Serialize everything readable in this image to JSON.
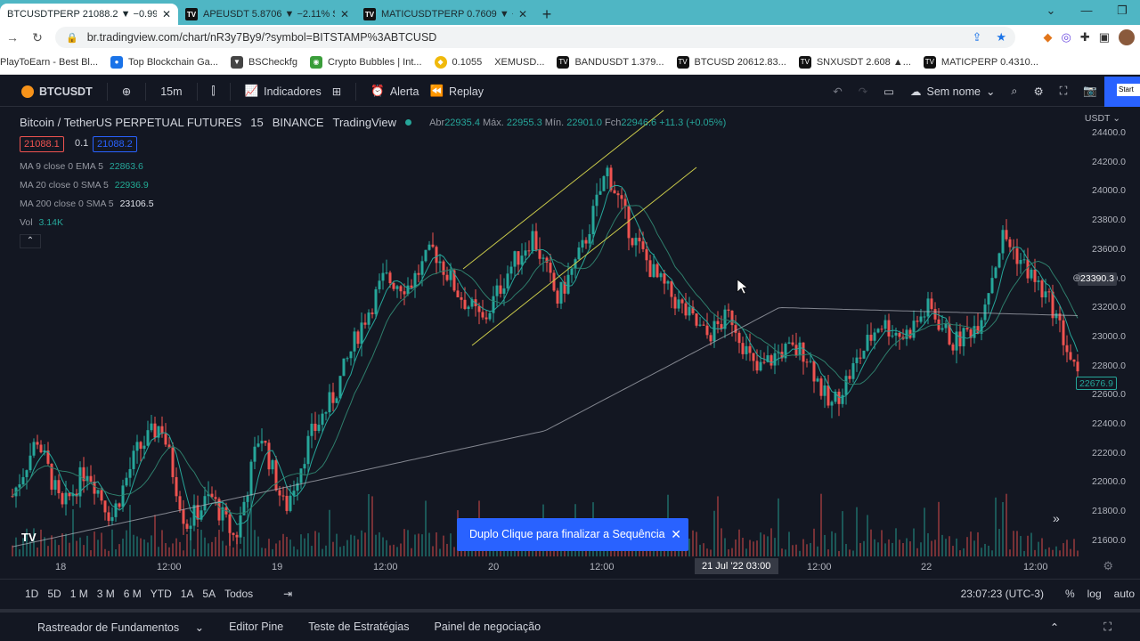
{
  "browser": {
    "tabs": [
      {
        "label": "BTCUSDTPERP 21088.2 ▼ −0.99%",
        "active": true
      },
      {
        "label": "APEUSDT 5.8706 ▼ −2.11% Sem",
        "active": false
      },
      {
        "label": "MATICUSDTPERP 0.7609 ▼ −1.1",
        "active": false
      }
    ],
    "url": "br.tradingview.com/chart/nR3y7By9/?symbol=BITSTAMP%3ABTCUSD",
    "bookmarks": [
      "PlayToEarn - Best Bl...",
      "Top Blockchain Ga...",
      "BSCheckfg",
      "Crypto Bubbles | Int...",
      "0.1055",
      "XEMUSD...",
      "BANDUSDT 1.379...",
      "BTCUSD 20612.83...",
      "SNXUSDT 2.608 ▲...",
      "MATICPERP 0.4310..."
    ]
  },
  "toolbar": {
    "symbol": "BTCUSDT",
    "interval": "15m",
    "indicators": "Indicadores",
    "alert": "Alerta",
    "replay": "Replay",
    "layout_name": "Sem nome",
    "start": "Start"
  },
  "legend": {
    "title": "Bitcoin / TetherUS PERPETUAL FUTURES",
    "interval": "15",
    "exchange": "BINANCE",
    "source": "TradingView",
    "open_label": "Abr",
    "open": "22935.4",
    "high_label": "Máx.",
    "high": "22955.3",
    "low_label": "Mín.",
    "low": "22901.0",
    "close_label": "Fch",
    "close": "22946.6",
    "change": "+11.3 (+0.05%)",
    "bid": "21088.1",
    "spread": "0.1",
    "ask": "21088.2"
  },
  "indicators": [
    {
      "label": "MA 9 close 0 EMA 5",
      "value": "22863.6",
      "color": "#26a69a"
    },
    {
      "label": "MA 20 close 0 SMA 5",
      "value": "22936.9",
      "color": "#22ab94"
    },
    {
      "label": "MA 200 close 0 SMA 5",
      "value": "23106.5",
      "color": "#e0e3eb"
    },
    {
      "label": "Vol",
      "value": "3.14K",
      "color": "#26a69a"
    }
  ],
  "yaxis": {
    "currency": "USDT",
    "ticks": [
      "24400.0",
      "24200.0",
      "24000.0",
      "23800.0",
      "23600.0",
      "23400.0",
      "23200.0",
      "23000.0",
      "22800.0",
      "22600.0",
      "22400.0",
      "22200.0",
      "22000.0",
      "21800.0",
      "21600.0"
    ],
    "crosshair_price": "23390.3",
    "last_price": "22676.9"
  },
  "xaxis": {
    "ticks": [
      "18",
      "12:00",
      "19",
      "12:00",
      "20",
      "12:00",
      "12:00",
      "22",
      "12:00"
    ],
    "crosshair_label": "21 Jul '22  03:00"
  },
  "toast": {
    "text": "Duplo Clique para finalizar a Sequência"
  },
  "bottom": {
    "ranges": [
      "1D",
      "5D",
      "1 M",
      "3 M",
      "6 M",
      "YTD",
      "1A",
      "5A",
      "Todos"
    ],
    "clock": "23:07:23 (UTC-3)",
    "percent": "%",
    "log": "log",
    "auto": "auto"
  },
  "panels": [
    "Rastreador de Fundamentos",
    "Editor Pine",
    "Teste de Estratégias",
    "Painel de negociação"
  ],
  "chart_data": {
    "type": "candlestick",
    "ylim": [
      21500,
      24500
    ],
    "colors": {
      "up": "#26a69a",
      "down": "#ef5350",
      "ma200": "#b2b5be",
      "channel": "#c9c94a"
    },
    "close_path": [
      21900,
      22300,
      21800,
      22100,
      21750,
      22200,
      22400,
      21700,
      21900,
      21600,
      22350,
      21800,
      22300,
      22600,
      23050,
      23400,
      23350,
      23600,
      23300,
      23100,
      23450,
      23700,
      23250,
      23600,
      24150,
      23700,
      23400,
      23200,
      23000,
      23150,
      22750,
      22900,
      22900,
      22500,
      22800,
      23100,
      23000,
      23200,
      22950,
      23100,
      23700,
      23450,
      23200,
      22700
    ]
  }
}
